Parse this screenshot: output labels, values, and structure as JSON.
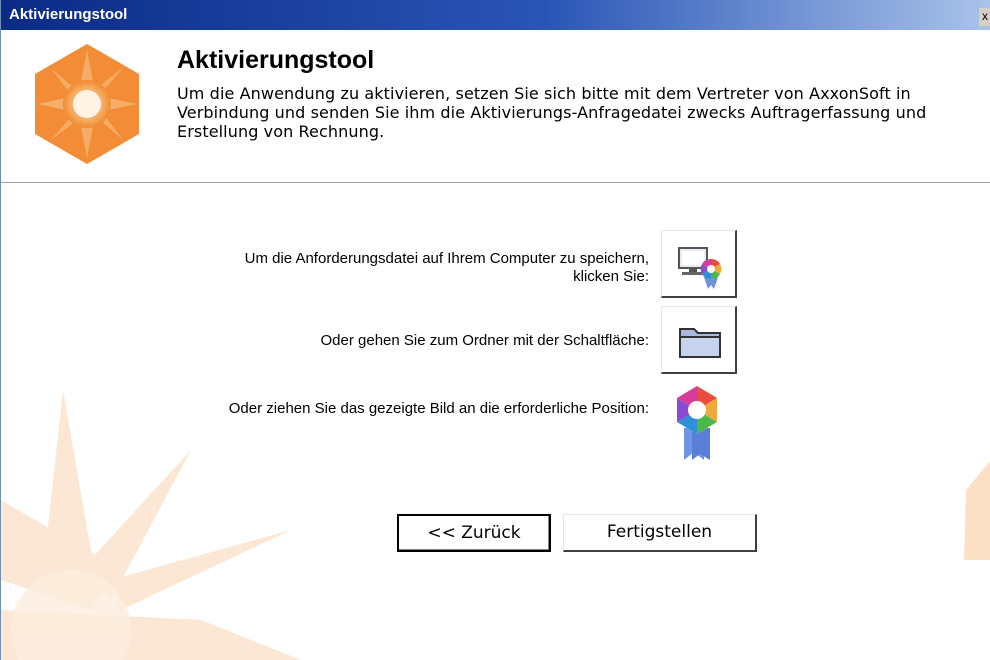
{
  "window": {
    "title": "Aktivierungstool",
    "close_glyph": "x",
    "close_icon": "close-icon"
  },
  "header": {
    "title": "Aktivierungstool",
    "description": "Um die Anwendung zu aktivieren, setzen Sie sich bitte mit dem Vertreter von AxxonSoft in Verbindung und senden Sie ihm die Aktivierungs-Anfragedatei zwecks Auftragerfassung und Erstellung von Rechnung.",
    "logo_icon": "axxon-logo-icon"
  },
  "options": {
    "save_label": "Um die Anforderungsdatei auf Ihrem Computer zu speichern, klicken Sie:",
    "save_icon": "computer-save-icon",
    "folder_label": "Oder gehen Sie zum Ordner mit der Schaltfläche:",
    "folder_icon": "folder-icon",
    "drag_label": "Oder ziehen Sie das gezeigte Bild an die erforderliche Position:",
    "drag_icon": "license-badge-icon"
  },
  "buttons": {
    "back_label": "<< Zurück",
    "finish_label": "Fertigstellen"
  },
  "colors": {
    "accent_orange": "#f39a4a",
    "titlebar_start": "#0b2a86",
    "titlebar_end": "#a9c3ea"
  }
}
